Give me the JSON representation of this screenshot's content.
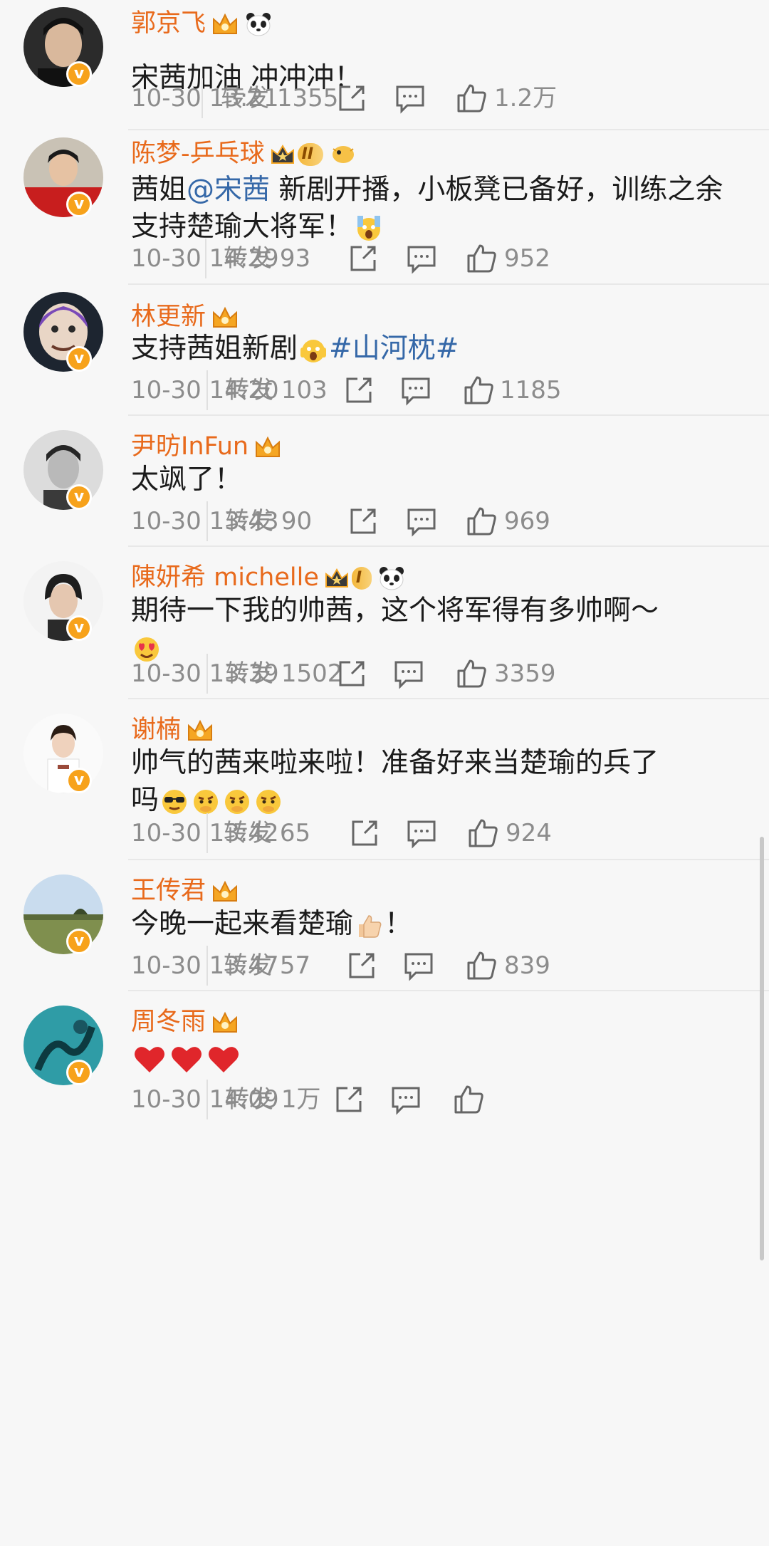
{
  "comments": [
    {
      "name": "郭京飞",
      "badges": [
        "crown",
        "panda"
      ],
      "text": "宋茜加油 冲冲冲！",
      "time": "10-30 13:21",
      "repost_label": "转发",
      "repost_count": "1355",
      "likes": "1.2万"
    },
    {
      "name": "陈梦-乒乓球",
      "badges": [
        "crown-level",
        "puffer"
      ],
      "level": "II",
      "text_parts": [
        "茜姐",
        "@宋茜",
        " 新剧开播，小板凳已备好，训练之余支持楚瑜大将军！"
      ],
      "time": "10-30 14:29",
      "repost_label": "转发",
      "repost_count": "93",
      "likes": "952"
    },
    {
      "name": "林更新",
      "badges": [
        "crown"
      ],
      "text_parts": [
        "支持茜姐新剧",
        "#山河枕#"
      ],
      "time": "10-30 14:20",
      "repost_label": "转发",
      "repost_count": "103",
      "likes": "1185"
    },
    {
      "name": "尹昉InFun",
      "badges": [
        "crown"
      ],
      "text": "太飒了！",
      "time": "10-30 13:43",
      "repost_label": "转发",
      "repost_count": "90",
      "likes": "969"
    },
    {
      "name": "陳妍希 michelle",
      "badges": [
        "crown-level",
        "panda"
      ],
      "level": "I",
      "text": "期待一下我的帅茜，这个将军得有多帅啊～",
      "time": "10-30 13:39",
      "repost_label": "转发",
      "repost_count": "1502",
      "likes": "3359"
    },
    {
      "name": "谢楠",
      "badges": [
        "crown"
      ],
      "text_parts": [
        "帅气的茜来啦来啦！准备好来当楚瑜的兵了",
        "吗"
      ],
      "time": "10-30 13:42",
      "repost_label": "转发",
      "repost_count": "65",
      "likes": "924"
    },
    {
      "name": "王传君",
      "badges": [
        "crown"
      ],
      "text_parts": [
        "今晚一起来看楚瑜",
        "！"
      ],
      "time": "10-30 13:47",
      "repost_label": "转发",
      "repost_count": "57",
      "likes": "839"
    },
    {
      "name": "周冬雨",
      "badges": [
        "crown"
      ],
      "text": "",
      "time": "10-30 14:09",
      "repost_label": "转发",
      "repost_count": "1万",
      "likes": ""
    }
  ],
  "colors": {
    "name": "#e86a1c",
    "link": "#3568a8",
    "meta": "#8c8c8c",
    "vbadge": "#f7a21b",
    "heart": "#e0262b"
  },
  "icons": [
    "share-icon",
    "comment-icon",
    "like-icon",
    "crown-icon",
    "panda-icon",
    "vip-badge-icon"
  ]
}
